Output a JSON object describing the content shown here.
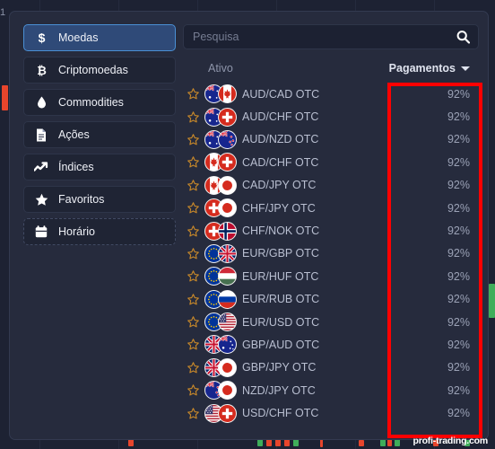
{
  "colors": {
    "app_bg": "#1d2233",
    "panel_bg": "#262b3d",
    "accent_blue": "#4a8fd4",
    "active_nav_bg": "#2f4a78",
    "annotation_red": "#ff0000",
    "star_gold": "#c7882a",
    "candle_up": "#3fae5a",
    "candle_down": "#e8452c"
  },
  "background": {
    "edge_label": "1"
  },
  "sidebar": {
    "items": [
      {
        "label": "Moedas",
        "icon": "dollar-icon",
        "active": true,
        "dashed": false
      },
      {
        "label": "Criptomoedas",
        "icon": "bitcoin-icon",
        "active": false,
        "dashed": false
      },
      {
        "label": "Commodities",
        "icon": "oil-drop-icon",
        "active": false,
        "dashed": false
      },
      {
        "label": "Ações",
        "icon": "document-icon",
        "active": false,
        "dashed": false
      },
      {
        "label": "Índices",
        "icon": "trend-up-icon",
        "active": false,
        "dashed": false
      },
      {
        "label": "Favoritos",
        "icon": "star-icon",
        "active": false,
        "dashed": false
      },
      {
        "label": "Horário",
        "icon": "calendar-icon",
        "active": false,
        "dashed": true
      }
    ]
  },
  "search": {
    "placeholder": "Pesquisa",
    "value": "",
    "icon": "search-icon"
  },
  "list_header": {
    "asset_label": "Ativo",
    "payout_label": "Pagamentos",
    "sort_icon": "chevron-down-icon"
  },
  "assets": [
    {
      "name": "AUD/CAD OTC",
      "payout": "92%",
      "flag1": "au",
      "flag2": "ca",
      "starred": false
    },
    {
      "name": "AUD/CHF OTC",
      "payout": "92%",
      "flag1": "au",
      "flag2": "ch",
      "starred": false
    },
    {
      "name": "AUD/NZD OTC",
      "payout": "92%",
      "flag1": "au",
      "flag2": "nz",
      "starred": false
    },
    {
      "name": "CAD/CHF OTC",
      "payout": "92%",
      "flag1": "ca",
      "flag2": "ch",
      "starred": false
    },
    {
      "name": "CAD/JPY OTC",
      "payout": "92%",
      "flag1": "ca",
      "flag2": "jp",
      "starred": false
    },
    {
      "name": "CHF/JPY OTC",
      "payout": "92%",
      "flag1": "ch",
      "flag2": "jp",
      "starred": false
    },
    {
      "name": "CHF/NOK OTC",
      "payout": "92%",
      "flag1": "ch",
      "flag2": "no",
      "starred": false
    },
    {
      "name": "EUR/GBP OTC",
      "payout": "92%",
      "flag1": "eu",
      "flag2": "gb",
      "starred": false
    },
    {
      "name": "EUR/HUF OTC",
      "payout": "92%",
      "flag1": "eu",
      "flag2": "hu",
      "starred": false
    },
    {
      "name": "EUR/RUB OTC",
      "payout": "92%",
      "flag1": "eu",
      "flag2": "ru",
      "starred": false
    },
    {
      "name": "EUR/USD OTC",
      "payout": "92%",
      "flag1": "eu",
      "flag2": "us",
      "starred": false
    },
    {
      "name": "GBP/AUD OTC",
      "payout": "92%",
      "flag1": "gb",
      "flag2": "au",
      "starred": false
    },
    {
      "name": "GBP/JPY OTC",
      "payout": "92%",
      "flag1": "gb",
      "flag2": "jp",
      "starred": false
    },
    {
      "name": "NZD/JPY OTC",
      "payout": "92%",
      "flag1": "nz",
      "flag2": "jp",
      "starred": false
    },
    {
      "name": "USD/CHF OTC",
      "payout": "92%",
      "flag1": "us",
      "flag2": "ch",
      "starred": false
    }
  ],
  "annotation": {
    "shape": "rectangle",
    "target": "payout-column"
  },
  "watermark": {
    "text": "profi-trading.com"
  }
}
